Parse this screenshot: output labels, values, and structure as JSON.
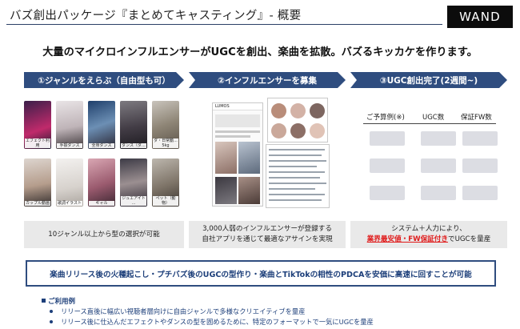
{
  "header": {
    "title": "バズ創出パッケージ『まとめてキャスティング』- 概要",
    "logo_text": "WAND"
  },
  "headline": "大量のマイクロインフルエンサーがUGCを創出、楽曲を拡散。バズるキッカケを作ります。",
  "steps": [
    {
      "label": "①ジャンルをえらぶ（自由型も可）"
    },
    {
      "label": "②インフルエンサーを募集"
    },
    {
      "label": "③UGC創出完了(2週間~)"
    }
  ],
  "genres": [
    {
      "caption": "エフェクト利用"
    },
    {
      "caption": "手振ダンス"
    },
    {
      "caption": "全身ダンス"
    },
    {
      "caption": "ダンス（ダ..."
    },
    {
      "caption": "ダ・日常動... 5kg"
    },
    {
      "caption": "Capture・フォント..."
    },
    {
      "caption": "カップル動画"
    },
    {
      "caption": "歌詞イラスト"
    },
    {
      "caption": "ギャル"
    },
    {
      "caption": "ジュエアイト ..."
    },
    {
      "caption": "映画あるある"
    },
    {
      "caption": "ペット（動物）"
    }
  ],
  "app_mock": {
    "brand": "LUMOS"
  },
  "results_table": {
    "headers": [
      "ご予算例(※)",
      "UGC数",
      "保証FW数"
    ]
  },
  "captions": [
    {
      "text": "10ジャンル以上から型の選択が可能"
    },
    {
      "line1": "3,000人弱のインフルエンサーが登録する",
      "line2": "自社アプリを通じて最適なアサインを実現"
    },
    {
      "line1": "システム＋人力により、",
      "highlight": "業界最安値・FW保証付き",
      "suffix": "でUGCを量産"
    }
  ],
  "banner": "楽曲リリース後の火種起こし・プチバズ後のUGCの型作り・楽曲とTikTokの相性のPDCAを安価に高速に回すことが可能",
  "usage": {
    "title": "ご利用例",
    "items": [
      "リリース直後に幅広い視聴者層向けに自由ジャンルで多様なクリエイティブを量産",
      "リリース後に仕込んだエフェクトやダンスの型を固めるために、特定のフォーマットで一気にUGCを量産"
    ]
  },
  "colors": {
    "accent": "#2f4d7f",
    "highlight": "#e01b1b",
    "text_blue": "#1d3f7a"
  }
}
